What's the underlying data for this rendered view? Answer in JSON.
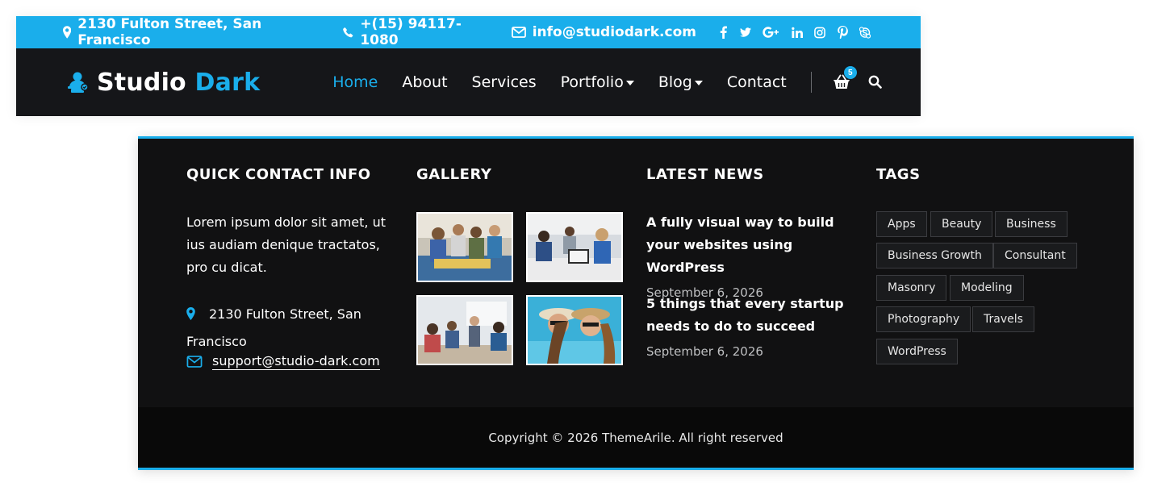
{
  "colors": {
    "accent": "#1aaeeb",
    "nav_bg": "#151619",
    "footer_bg": "#111112"
  },
  "topbar": {
    "address": "2130 Fulton Street, San Francisco",
    "phone": "+(15) 94117-1080",
    "email": "info@studiodark.com",
    "social_icons": [
      "facebook-icon",
      "twitter-icon",
      "google-plus-icon",
      "linkedin-icon",
      "instagram-icon",
      "pinterest-icon",
      "skype-icon"
    ]
  },
  "brand": {
    "name_primary": "Studio",
    "name_accent": "Dark"
  },
  "nav": {
    "items": [
      {
        "label": "Home",
        "active": true
      },
      {
        "label": "About"
      },
      {
        "label": "Services"
      },
      {
        "label": "Portfolio",
        "dropdown": true
      },
      {
        "label": "Blog",
        "dropdown": true
      },
      {
        "label": "Contact"
      }
    ],
    "cart_count": "5"
  },
  "footer": {
    "quick_contact": {
      "title": "QUICK CONTACT INFO",
      "about": "Lorem ipsum dolor sit amet, ut ius audiam denique tractatos, pro cu dicat.",
      "address": "2130 Fulton Street, San Francisco",
      "email": "support@studio-dark.com"
    },
    "gallery": {
      "title": "GALLERY"
    },
    "latest_news": {
      "title": "LATEST NEWS",
      "items": [
        {
          "title": "A fully visual way to build your websites using WordPress",
          "date": "September 6, 2026"
        },
        {
          "title": "5 things that every startup needs to do to succeed",
          "date": "September 6, 2026"
        }
      ]
    },
    "tags": {
      "title": "TAGS",
      "items": [
        "Apps",
        "Beauty",
        "Business",
        "Business Growth",
        "Consultant",
        "Masonry",
        "Modeling",
        "Photography",
        "Travels",
        "WordPress"
      ]
    },
    "copyright": "Copyright © 2026 ThemeArile. All right reserved"
  }
}
